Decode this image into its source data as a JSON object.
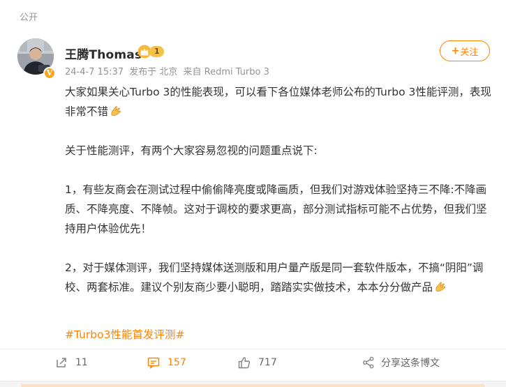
{
  "post": {
    "visibility": "公开",
    "author": {
      "name": "王腾Thomas",
      "level": "1",
      "verified_badge": "V"
    },
    "meta": {
      "time": "24-4-7 15:37",
      "location": "发布于 北京",
      "source": "来自 Redmi Turbo 3"
    },
    "follow_label": "关注",
    "body": {
      "p1": "大家如果关心Turbo 3的性能表现，可以看下各位媒体老师公布的Turbo 3性能评测，表现非常不错",
      "p2": "关于性能测评，有两个大家容易忽视的问题重点说下:",
      "p3": "1，有些友商会在测试过程中偷偷降亮度或降画质，但我们对游戏体验坚持三不降:不降画质、不降亮度、不降帧。这对于调校的要求更高，部分测试指标可能不占优势，但我们坚持用户体验优先！",
      "p4": "2，对于媒体测评，我们坚持媒体送测版和用户量产版是同一套软件版本，不搞“阴阳”调校、两套标准。建议个别友商少要小聪明，踏踏实实做技术，本本分分做产品"
    },
    "hashtag": "#Turbo3性能首发评测#",
    "actions": {
      "repost_count": "11",
      "comment_count": "157",
      "like_count": "717",
      "share_label": "分享这条博文"
    },
    "colors": {
      "accent": "#ff8200",
      "text": "#333333",
      "muted": "#939393"
    },
    "icons": [
      "repost-icon",
      "comment-icon",
      "like-icon",
      "share-icon",
      "crown-icon",
      "hands-together-emoji"
    ]
  }
}
